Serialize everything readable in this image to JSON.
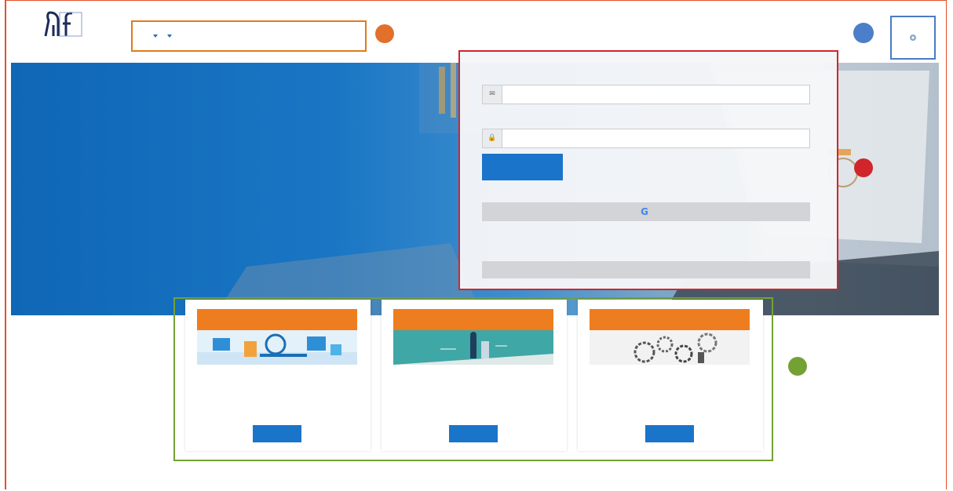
{
  "colors": {
    "accent_blue": "#1a74c9",
    "card_header_orange": "#ee7d1f",
    "callout_orange": "#e07b1a",
    "callout_blue": "#4a7bc4",
    "callout_red": "#d0262b",
    "callout_green": "#74a134"
  },
  "logo": {
    "icon": "university-logo-icon",
    "text_line1": "",
    "text_line2": ""
  },
  "nav": {
    "items": [
      {
        "label": "",
        "dropdown": false
      },
      {
        "label": "",
        "dropdown": false
      },
      {
        "label": "",
        "dropdown": true
      },
      {
        "label": "",
        "dropdown": true
      }
    ]
  },
  "callouts": {
    "one": "",
    "two": "",
    "three": "",
    "four": ""
  },
  "header": {
    "settings_icon": "gear-icon"
  },
  "hero": {
    "title": ""
  },
  "login": {
    "username_label": "",
    "username_placeholder": "",
    "password_label": "",
    "password_placeholder": "",
    "submit_label": "",
    "alt_login_text": "",
    "google_label": "",
    "forgot_link": "",
    "anonymous_label": ""
  },
  "cards": [
    {
      "title": "",
      "text": "",
      "button": ""
    },
    {
      "title": "",
      "text": "",
      "button": ""
    },
    {
      "title": "",
      "text": "",
      "button": ""
    }
  ]
}
